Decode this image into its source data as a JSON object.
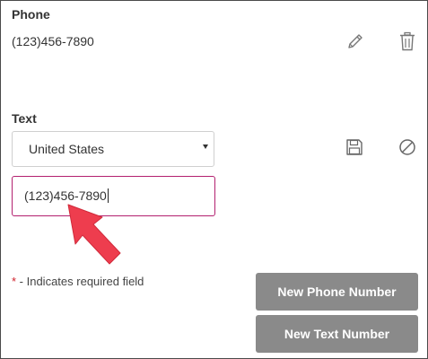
{
  "phone": {
    "label": "Phone",
    "value": "(123)456-7890",
    "edit_icon": "pencil-icon",
    "delete_icon": "trash-icon"
  },
  "text": {
    "label": "Text",
    "country_selected": "United States",
    "number_value": "(123)456-7890",
    "save_icon": "floppy-disk-icon",
    "cancel_icon": "circle-slash-icon"
  },
  "required_note": {
    "star": "*",
    "text": " - Indicates required field"
  },
  "buttons": {
    "new_phone": "New Phone Number",
    "new_text": "New Text Number"
  },
  "colors": {
    "active_border": "#b3206f",
    "button_bg": "#8a8a8a",
    "required_star": "#d0202b",
    "annotation_arrow": "#ee3d4e"
  }
}
